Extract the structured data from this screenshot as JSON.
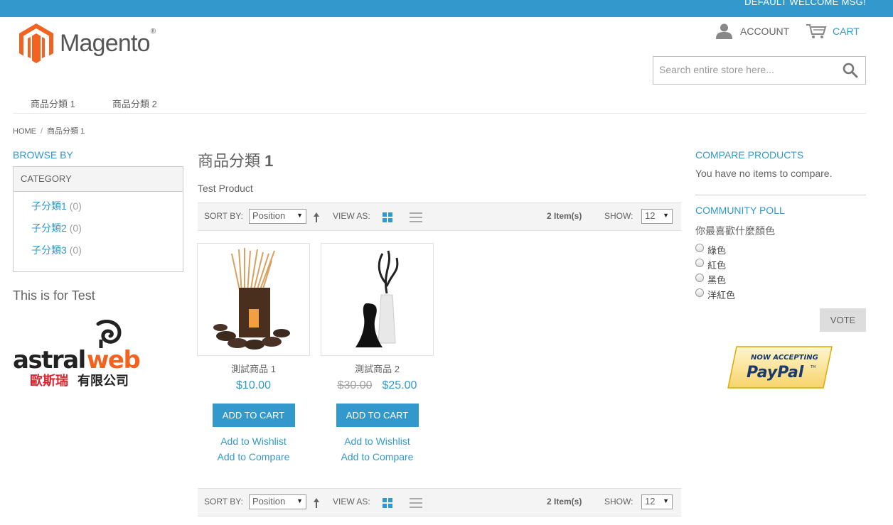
{
  "header": {
    "welcome": "DEFAULT WELCOME MSG!",
    "logo_text": "Magento",
    "logo_reg": "®",
    "account_label": "ACCOUNT",
    "cart_label": "CART",
    "search_placeholder": "Search entire store here..."
  },
  "nav": {
    "items": [
      "商品分類 1",
      "商品分類 2"
    ]
  },
  "breadcrumb": {
    "home": "HOME",
    "separator": "/",
    "current": "商品分類 1"
  },
  "sidebar": {
    "browse_title": "BROWSE BY",
    "category_title": "CATEGORY",
    "categories": [
      {
        "label": "子分類1",
        "count": "(0)"
      },
      {
        "label": "子分類2",
        "count": "(0)"
      },
      {
        "label": "子分類3",
        "count": "(0)"
      }
    ],
    "promo_text": "This is for Test",
    "astral_logo": {
      "text": "astralweb",
      "subtext": "歐斯瑞有限公司"
    }
  },
  "main": {
    "title": "商品分類",
    "title_num": "1",
    "description": "Test Product",
    "toolbar": {
      "sort_label": "SORT BY:",
      "sort_value": "Position",
      "sort_dir_icon": "arrow-up-icon",
      "view_label": "VIEW AS:",
      "items_count": "2 Item(s)",
      "show_label": "SHOW:",
      "show_value": "12"
    },
    "products": [
      {
        "name": "測試商品 1",
        "price": "$10.00",
        "old_price": "",
        "add_to_cart": "ADD TO CART",
        "wishlist": "Add to Wishlist",
        "compare": "Add to Compare"
      },
      {
        "name": "測試商品 2",
        "price": "$25.00",
        "old_price": "$30.00",
        "add_to_cart": "ADD TO CART",
        "wishlist": "Add to Wishlist",
        "compare": "Add to Compare"
      }
    ]
  },
  "right": {
    "compare_title": "COMPARE PRODUCTS",
    "compare_text": "You have no items to compare.",
    "poll_title": "COMMUNITY POLL",
    "poll_question": "你最喜歡什麼顏色",
    "poll_options": [
      "綠色",
      "紅色",
      "黑色",
      "洋紅色"
    ],
    "vote_label": "VOTE",
    "paypal": {
      "line1": "NOW ACCEPTING",
      "line2": "PayPal",
      "tm": "TM"
    }
  },
  "colors": {
    "accent": "#3399cc",
    "text": "#636363",
    "logo_orange": "#f26322",
    "toolbar_bg": "#f4f4f4"
  }
}
